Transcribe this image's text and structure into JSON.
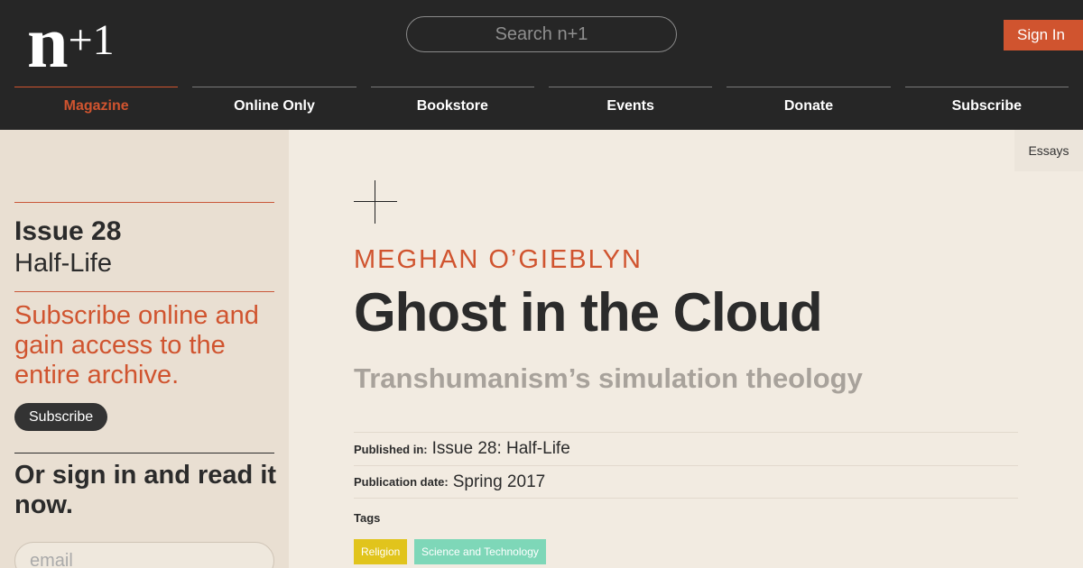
{
  "header": {
    "logo_main": "n",
    "logo_plus": "+1",
    "search_placeholder": "Search n+1",
    "signin_label": "Sign In"
  },
  "nav": {
    "items": [
      {
        "label": "Magazine",
        "active": true
      },
      {
        "label": "Online Only"
      },
      {
        "label": "Bookstore"
      },
      {
        "label": "Events"
      },
      {
        "label": "Donate"
      },
      {
        "label": "Subscribe"
      }
    ]
  },
  "sidebar": {
    "issue_number": "Issue 28",
    "issue_name": "Half-Life",
    "subscribe_pitch": "Subscribe online and gain access to the entire archive.",
    "subscribe_button": "Subscribe",
    "signin_pitch": "Or sign in and read it now.",
    "email_placeholder": "email"
  },
  "article": {
    "section_tab": "Essays",
    "author": "MEGHAN O’GIEBLYN",
    "title": "Ghost in the Cloud",
    "subtitle": "Transhumanism’s simulation theology",
    "published_in_label": "Published in:",
    "published_in_value": "Issue 28: Half-Life",
    "pub_date_label": "Publication date:",
    "pub_date_value": "Spring 2017",
    "tags_label": "Tags",
    "tags": [
      "Religion",
      "Science and Technology"
    ]
  },
  "colors": {
    "accent": "#d0542f",
    "header_bg": "#262626",
    "page_bg": "#f2ebe1",
    "sidebar_bg": "#e9dfd2",
    "tag_religion": "#e1c41c",
    "tag_scitech": "#7ed7b8"
  }
}
